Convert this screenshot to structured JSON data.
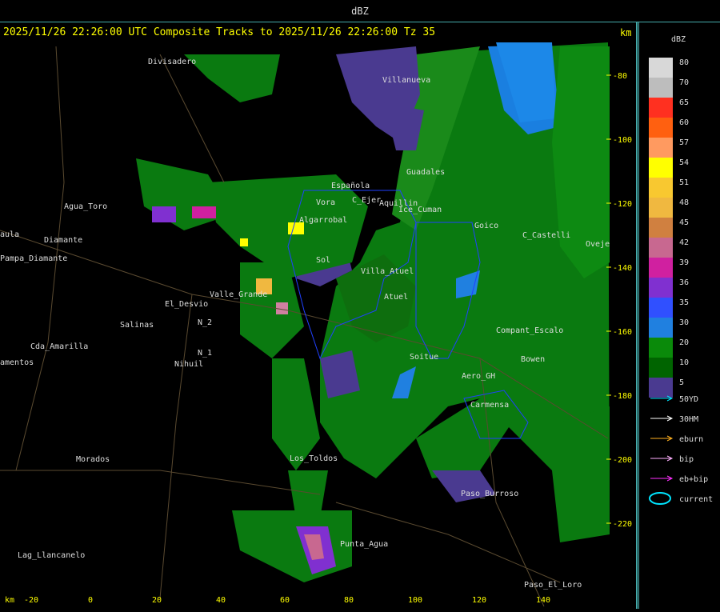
{
  "window": {
    "title": "dBZ"
  },
  "header": {
    "text": "2025/11/26 22:26:00 UTC Composite Tracks to 2025/11/26 22:26:00 Tz 35",
    "km_label": "km"
  },
  "axis": {
    "x_unit": "km",
    "x_ticks": [
      "-20",
      "0",
      "20",
      "40",
      "60",
      "80",
      "100",
      "120",
      "140"
    ],
    "y_ticks": [
      "-80",
      "-100",
      "-120",
      "-140",
      "-160",
      "-180",
      "-200",
      "-220"
    ]
  },
  "places": [
    {
      "name": "Divisadero"
    },
    {
      "name": "Villanueva"
    },
    {
      "name": "Guadales"
    },
    {
      "name": "Española"
    },
    {
      "name": "Vora"
    },
    {
      "name": "Aquillin"
    },
    {
      "name": "C_Ejer"
    },
    {
      "name": "Ice_Cuman"
    },
    {
      "name": "Goico"
    },
    {
      "name": "Oveje"
    },
    {
      "name": "Agua_Toro"
    },
    {
      "name": "Pampa_Diamante"
    },
    {
      "name": "Diamante"
    },
    {
      "name": "El_Desvio"
    },
    {
      "name": "Valle_Grande"
    },
    {
      "name": "Salinas"
    },
    {
      "name": "N_2"
    },
    {
      "name": "N_1"
    },
    {
      "name": "Nihuil"
    },
    {
      "name": "Cda_Amarilla"
    },
    {
      "name": "amentos"
    },
    {
      "name": "Morados"
    },
    {
      "name": "Los_Toldos"
    },
    {
      "name": "Soitue"
    },
    {
      "name": "Aero_GH"
    },
    {
      "name": "Carmensa"
    },
    {
      "name": "Bowen"
    },
    {
      "name": "Paso_Burroso"
    },
    {
      "name": "Punta_Agua"
    },
    {
      "name": "Lag_Llancanelo"
    },
    {
      "name": "Paso_El_Loro"
    },
    {
      "name": "aula"
    },
    {
      "name": "Atuel"
    },
    {
      "name": "C_Castelli"
    },
    {
      "name": "Compant_Escalo"
    },
    {
      "name": "Villa_Atuel"
    },
    {
      "name": "Sol"
    },
    {
      "name": "Algarrobal"
    }
  ],
  "legend": {
    "title": "dBZ",
    "scale": [
      {
        "label": "80",
        "color": "#d8d8d8"
      },
      {
        "label": "70",
        "color": "#bdbdbd"
      },
      {
        "label": "65",
        "color": "#ff3020"
      },
      {
        "label": "60",
        "color": "#ff6010"
      },
      {
        "label": "57",
        "color": "#ff9a60"
      },
      {
        "label": "54",
        "color": "#ffff00"
      },
      {
        "label": "51",
        "color": "#f8c830"
      },
      {
        "label": "48",
        "color": "#f0b840"
      },
      {
        "label": "45",
        "color": "#d08040"
      },
      {
        "label": "42",
        "color": "#c86890"
      },
      {
        "label": "39",
        "color": "#d020a0"
      },
      {
        "label": "36",
        "color": "#8030d0"
      },
      {
        "label": "35",
        "color": "#3050ff"
      },
      {
        "label": "30",
        "color": "#2080e0"
      },
      {
        "label": "20",
        "color": "#0a8a0a"
      },
      {
        "label": "10",
        "color": "#006400"
      },
      {
        "label": "5",
        "color": "#4a3a90"
      }
    ],
    "tracks": [
      {
        "label": "50YD",
        "color": "#00e5ff"
      },
      {
        "label": "30HM",
        "color": "#ffffff"
      },
      {
        "label": "eburn",
        "color": "#ffb020"
      },
      {
        "label": "bip",
        "color": "#ffb0ff"
      },
      {
        "label": "eb+bip",
        "color": "#ff30ff"
      },
      {
        "label": "current",
        "color": "#00e5ff"
      }
    ]
  }
}
